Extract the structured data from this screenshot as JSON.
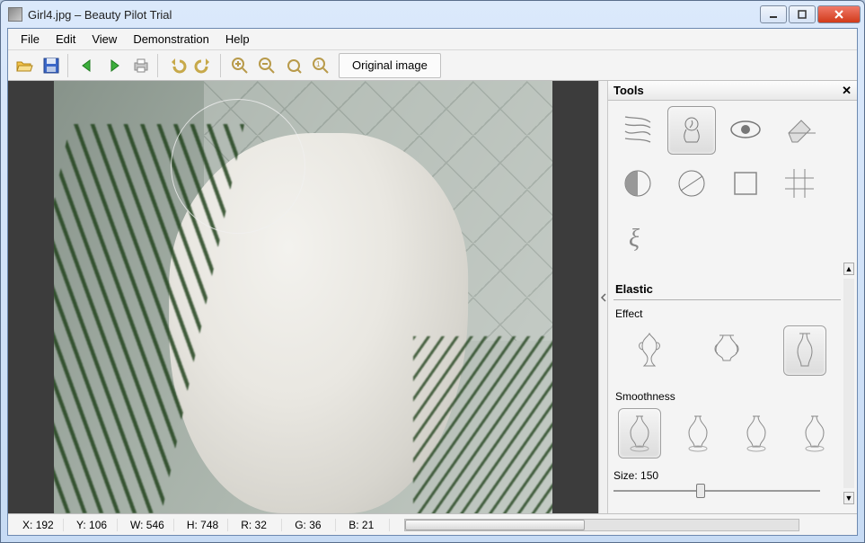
{
  "window": {
    "title": "Girl4.jpg – Beauty Pilot Trial"
  },
  "menu": {
    "file": "File",
    "edit": "Edit",
    "view": "View",
    "demonstration": "Demonstration",
    "help": "Help"
  },
  "toolbar": {
    "open": "open-icon",
    "save": "save-icon",
    "back": "arrow-back-icon",
    "forward": "arrow-forward-icon",
    "print": "print-icon",
    "undo": "undo-icon",
    "redo": "redo-icon",
    "zoom_in": "zoom-in-icon",
    "zoom_out": "zoom-out-icon",
    "zoom_fit": "zoom-fit-icon",
    "zoom_actual": "zoom-actual-icon",
    "original_label": "Original image"
  },
  "tools_panel": {
    "title": "Tools",
    "tools": [
      {
        "name": "hair-tool-icon"
      },
      {
        "name": "elastic-tool-icon",
        "selected": true
      },
      {
        "name": "eye-tool-icon"
      },
      {
        "name": "eraser-icon"
      },
      {
        "name": "contrast-circle-icon"
      },
      {
        "name": "line-circle-icon"
      },
      {
        "name": "rectangle-icon"
      },
      {
        "name": "crop-grid-icon"
      },
      {
        "name": "xi-icon"
      }
    ],
    "section_label": "Elastic",
    "effect_label": "Effect",
    "effects": [
      {
        "name": "ornate-vase-icon"
      },
      {
        "name": "wide-vase-icon"
      },
      {
        "name": "tall-vase-icon",
        "selected": true
      }
    ],
    "smoothness_label": "Smoothness",
    "smoothness": [
      {
        "name": "smooth-vase-1-icon",
        "selected": true
      },
      {
        "name": "smooth-vase-2-icon"
      },
      {
        "name": "smooth-vase-3-icon"
      },
      {
        "name": "smooth-vase-4-icon"
      }
    ],
    "size_label": "Size:",
    "size_value": "150"
  },
  "status": {
    "x_label": "X:",
    "x": "192",
    "y_label": "Y:",
    "y": "106",
    "w_label": "W:",
    "w": "546",
    "h_label": "H:",
    "h": "748",
    "r_label": "R:",
    "r": "32",
    "g_label": "G:",
    "g": "36",
    "b_label": "B:",
    "b": "21"
  }
}
